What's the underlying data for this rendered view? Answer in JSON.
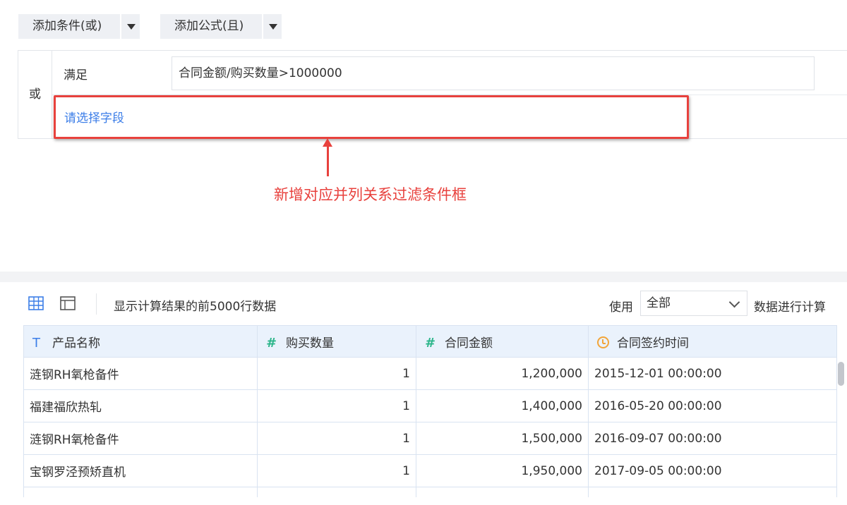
{
  "filter": {
    "add_condition_or_label": "添加条件(或)",
    "add_formula_and_label": "添加公式(且)",
    "group_operator": "或",
    "satisfy_label": "满足",
    "formula_value": "合同金额/购买数量>1000000",
    "select_field_placeholder": "请选择字段"
  },
  "annotation": {
    "text": "新增对应并列关系过滤条件框",
    "color": "#e8413d"
  },
  "toolbar": {
    "result_text": "显示计算结果的前5000行数据",
    "use_label": "使用",
    "use_select_value": "全部",
    "calc_label": "数据进行计算"
  },
  "table": {
    "headers": [
      {
        "icon": "text-type-icon",
        "label": "产品名称"
      },
      {
        "icon": "number-type-icon",
        "label": "购买数量"
      },
      {
        "icon": "number-type-icon",
        "label": "合同金额"
      },
      {
        "icon": "date-type-icon",
        "label": "合同签约时间"
      }
    ],
    "rows": [
      [
        "涟钢RH氧枪备件",
        "1",
        "1,200,000",
        "2015-12-01 00:00:00"
      ],
      [
        "福建福欣热轧",
        "1",
        "1,400,000",
        "2016-05-20 00:00:00"
      ],
      [
        "涟钢RH氧枪备件",
        "1",
        "1,500,000",
        "2016-09-07 00:00:00"
      ],
      [
        "宝钢罗泾预矫直机",
        "1",
        "1,950,000",
        "2017-09-05 00:00:00"
      ]
    ]
  },
  "colors": {
    "link": "#3c7ee8",
    "annotation": "#e8413d",
    "header_bg": "#eaf2fc"
  }
}
